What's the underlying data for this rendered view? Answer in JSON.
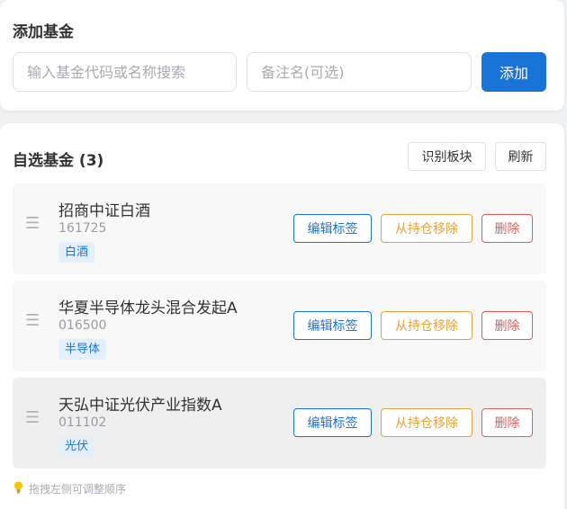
{
  "add_section": {
    "title": "添加基金",
    "code_placeholder": "输入基金代码或名称搜索",
    "remark_placeholder": "备注名(可选)",
    "add_label": "添加"
  },
  "list_section": {
    "title": "自选基金 (3)",
    "identify_label": "识别板块",
    "refresh_label": "刷新",
    "funds": [
      {
        "name": "招商中证白酒",
        "code": "161725",
        "tag": "白酒"
      },
      {
        "name": "华夏半导体龙头混合发起A",
        "code": "016500",
        "tag": "半导体"
      },
      {
        "name": "天弘中证光伏产业指数A",
        "code": "011102",
        "tag": "光伏"
      }
    ],
    "actions": {
      "edit_label": "编辑标签",
      "remove_label": "从持仓移除",
      "delete_label": "删除"
    },
    "hint": "拖拽左侧可调整顺序"
  },
  "icons": {
    "drag": "drag-handle-icon",
    "hint": "lightbulb-icon"
  },
  "colors": {
    "primary": "#1a73d6",
    "warning": "#e6a23c",
    "danger": "#e25c5c",
    "tag_bg": "#e3f0fc"
  }
}
